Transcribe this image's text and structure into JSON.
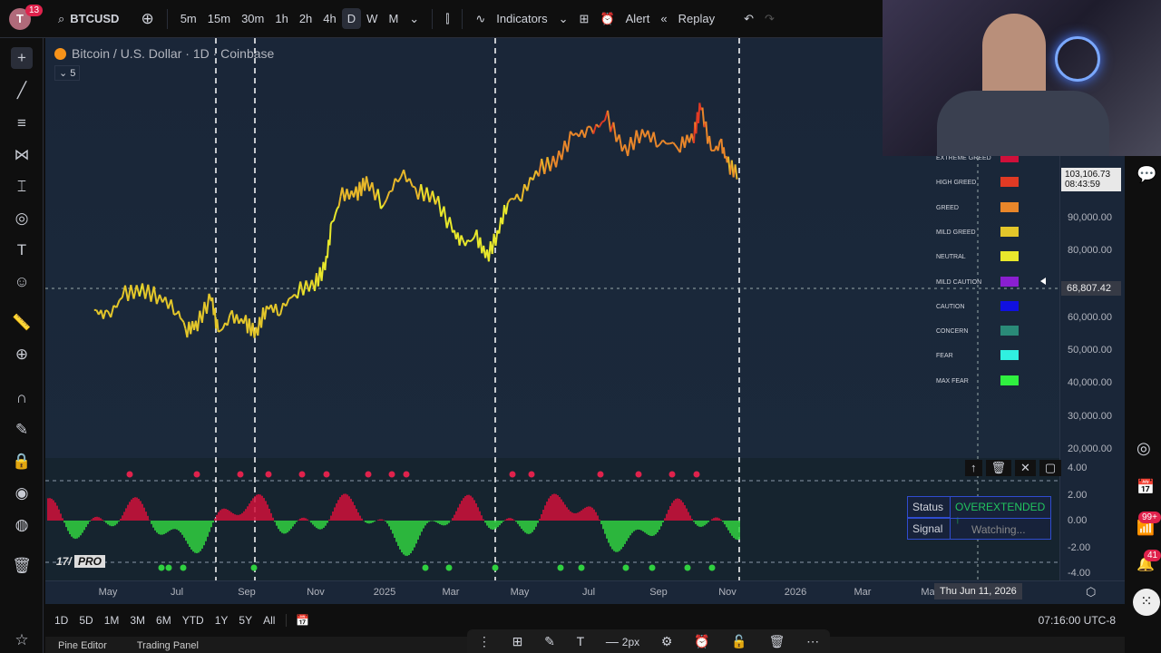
{
  "topbar": {
    "notif_count": "13",
    "avatar_letter": "T",
    "symbol": "BTCUSD",
    "intervals": [
      "5m",
      "15m",
      "30m",
      "1h",
      "2h",
      "4h",
      "D",
      "W",
      "M"
    ],
    "active_interval": "D",
    "indicators": "Indicators",
    "alert": "Alert",
    "replay": "Replay"
  },
  "chart": {
    "title": "Bitcoin / U.S. Dollar · 1D · Coinbase",
    "indicator_count": "5",
    "watermark": "PRO"
  },
  "price_axis": {
    "labels": [
      "90,000.00",
      "80,000.00",
      "60,000.00",
      "50,000.00",
      "40,000.00",
      "30,000.00",
      "20,000.00"
    ],
    "last_price": "103,106.73",
    "countdown": "08:43:59",
    "crosshair_price": "68,807.42"
  },
  "osc_axis": {
    "labels": [
      "4.00",
      "2.00",
      "0.00",
      "-2.00",
      "-4.00"
    ]
  },
  "time_axis": {
    "labels": [
      "May",
      "Jul",
      "Sep",
      "Nov",
      "2025",
      "Mar",
      "May",
      "Jul",
      "Sep",
      "Nov",
      "2026",
      "Mar",
      "Ma"
    ],
    "crosshair_date": "Thu Jun 11, 2026"
  },
  "legend": [
    {
      "label": "Extreme Greed",
      "color": "#d0103a"
    },
    {
      "label": "High Greed",
      "color": "#e03a24"
    },
    {
      "label": "Greed",
      "color": "#e8862a"
    },
    {
      "label": "Mild Greed",
      "color": "#e3c62a"
    },
    {
      "label": "Neutral",
      "color": "#e8e82c"
    },
    {
      "label": "Mild Caution",
      "color": "#8a1fd0"
    },
    {
      "label": "Caution",
      "color": "#1010e0"
    },
    {
      "label": "Concern",
      "color": "#2a8a78"
    },
    {
      "label": "Fear",
      "color": "#30f0e0"
    },
    {
      "label": "Max Fear",
      "color": "#30f040"
    }
  ],
  "status_table": {
    "status_label": "Status",
    "status_value": "OVEREXTENDED ↑",
    "signal_label": "Signal",
    "signal_value": "Watching..."
  },
  "range": {
    "buttons": [
      "1D",
      "5D",
      "1M",
      "3M",
      "6M",
      "YTD",
      "1Y",
      "5Y",
      "All"
    ],
    "time": "07:16:00 UTC-8"
  },
  "right_badges": {
    "feed": "99+",
    "alerts": "41"
  },
  "bottom": {
    "pine": "Pine Editor",
    "trading": "Trading Panel",
    "stroke": "2px"
  },
  "chart_data": {
    "type": "line",
    "xunit": "months since Jan 2024",
    "points": [
      [
        3.6,
        62000
      ],
      [
        4,
        60000
      ],
      [
        4.5,
        67000
      ],
      [
        5,
        68000
      ],
      [
        5.5,
        66000
      ],
      [
        6,
        62000
      ],
      [
        6.3,
        56000
      ],
      [
        6.6,
        58000
      ],
      [
        7,
        66000
      ],
      [
        7.2,
        55000
      ],
      [
        7.6,
        60000
      ],
      [
        8,
        58000
      ],
      [
        8.3,
        55000
      ],
      [
        8.6,
        63000
      ],
      [
        9,
        62000
      ],
      [
        9.5,
        68000
      ],
      [
        10,
        70000
      ],
      [
        10.3,
        75000
      ],
      [
        10.5,
        88000
      ],
      [
        10.8,
        97000
      ],
      [
        11.2,
        97000
      ],
      [
        11.5,
        101000
      ],
      [
        12,
        94000
      ],
      [
        12.5,
        104000
      ],
      [
        13,
        98000
      ],
      [
        13.5,
        96000
      ],
      [
        14,
        86000
      ],
      [
        14.3,
        82000
      ],
      [
        14.7,
        84000
      ],
      [
        15,
        78000
      ],
      [
        15.3,
        85000
      ],
      [
        15.6,
        95000
      ],
      [
        16,
        97000
      ],
      [
        16.5,
        105000
      ],
      [
        17,
        107000
      ],
      [
        17.5,
        115000
      ],
      [
        18,
        116000
      ],
      [
        18.5,
        120000
      ],
      [
        19,
        110000
      ],
      [
        19.5,
        116000
      ],
      [
        20,
        113000
      ],
      [
        20.6,
        112000
      ],
      [
        21,
        115000
      ],
      [
        21.2,
        124000
      ],
      [
        21.5,
        110000
      ],
      [
        21.8,
        112000
      ],
      [
        22,
        106000
      ],
      [
        22.3,
        103000
      ]
    ]
  }
}
